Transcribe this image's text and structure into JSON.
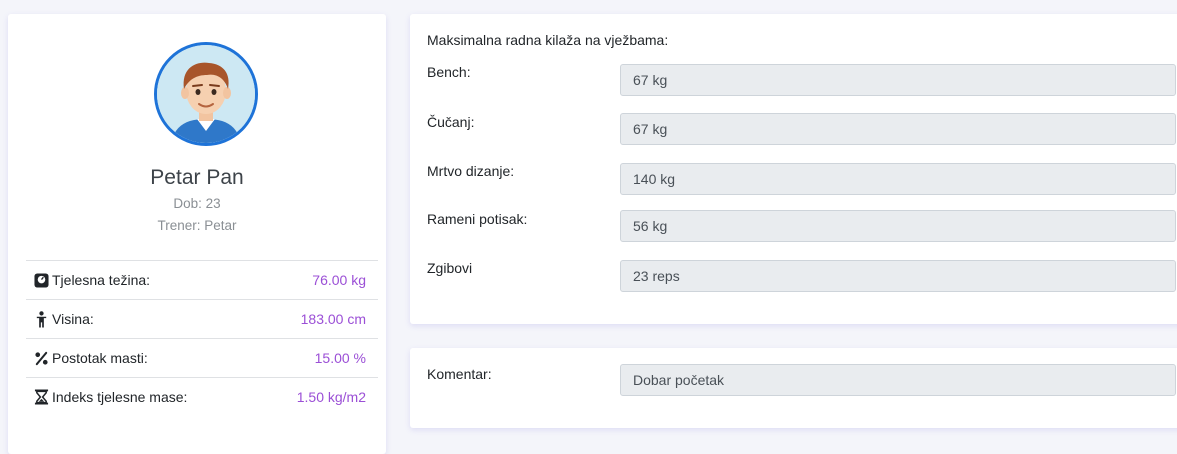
{
  "profile": {
    "name": "Petar Pan",
    "age_line": "Dob: 23",
    "trainer_line": "Trener: Petar",
    "stats": [
      {
        "icon": "weight-scale-icon",
        "label": "Tjelesna težina:",
        "value": "76.00 kg"
      },
      {
        "icon": "person-height-icon",
        "label": "Visina:",
        "value": "183.00 cm"
      },
      {
        "icon": "percent-icon",
        "label": "Postotak masti:",
        "value": "15.00 %"
      },
      {
        "icon": "hourglass-icon",
        "label": "Indeks tjelesne mase:",
        "value": "1.50 kg/m2"
      }
    ]
  },
  "lifts": {
    "title": "Maksimalna radna kilaža na vježbama:",
    "items": [
      {
        "label": "Bench:",
        "value": "67 kg"
      },
      {
        "label": "Čučanj:",
        "value": "67 kg"
      },
      {
        "label": "Mrtvo dizanje:",
        "value": "140 kg"
      },
      {
        "label": "Rameni potisak:",
        "value": "56 kg"
      },
      {
        "label": "Zgibovi",
        "value": "23 reps"
      }
    ]
  },
  "comment": {
    "label": "Komentar:",
    "value": "Dobar početak"
  },
  "colors": {
    "accent_value": "#9b4fd6",
    "avatar_border": "#1e73d8",
    "input_bg": "#e9ecef"
  }
}
